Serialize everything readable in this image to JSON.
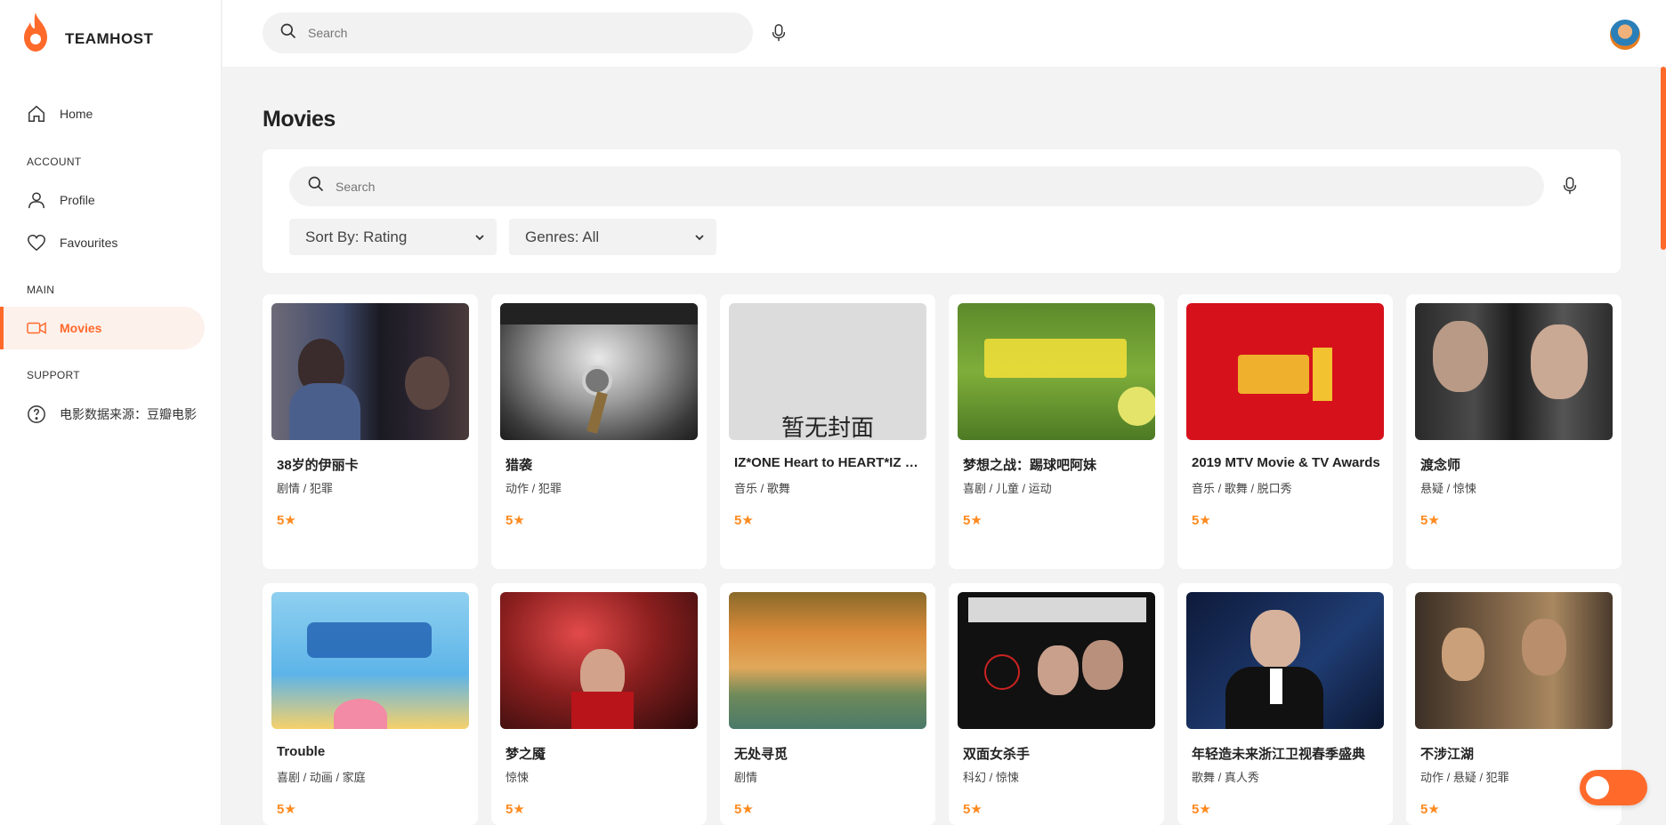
{
  "brand": {
    "name": "TEAMHOST",
    "accent": "#ff6a2b"
  },
  "sidebar": {
    "home": "Home",
    "account_label": "ACCOUNT",
    "profile": "Profile",
    "favourites": "Favourites",
    "main_label": "MAIN",
    "movies": "Movies",
    "support_label": "SUPPORT",
    "source": "电影数据来源：豆瓣电影"
  },
  "top_search": {
    "placeholder": "Search"
  },
  "page_title": "Movies",
  "filters": {
    "search_placeholder": "Search",
    "sort": "Sort By: Rating",
    "genres": "Genres: All"
  },
  "movies": [
    {
      "title": "38岁的伊丽卡",
      "genres": "剧情 / 犯罪",
      "rating": "5★"
    },
    {
      "title": "猎袭",
      "genres": "动作 / 犯罪",
      "rating": "5★"
    },
    {
      "title": "IZ*ONE Heart to HEART*IZ Concert",
      "genres": "音乐 / 歌舞",
      "rating": "5★",
      "poster_text": "暂无封面"
    },
    {
      "title": "梦想之战：踢球吧阿妹",
      "genres": "喜剧 / 儿童 / 运动",
      "rating": "5★"
    },
    {
      "title": "2019 MTV Movie & TV Awards",
      "genres": "音乐 / 歌舞 / 脱口秀",
      "rating": "5★"
    },
    {
      "title": "渡念师",
      "genres": "悬疑 / 惊悚",
      "rating": "5★"
    },
    {
      "title": "Trouble",
      "genres": "喜剧 / 动画 / 家庭",
      "rating": "5★"
    },
    {
      "title": "梦之魇",
      "genres": "惊悚",
      "rating": "5★"
    },
    {
      "title": "无处寻觅",
      "genres": "剧情",
      "rating": "5★"
    },
    {
      "title": "双面女杀手",
      "genres": "科幻 / 惊悚",
      "rating": "5★"
    },
    {
      "title": "年轻造未来浙江卫视春季盛典",
      "genres": "歌舞 / 真人秀",
      "rating": "5★"
    },
    {
      "title": "不涉江湖",
      "genres": "动作 / 悬疑 / 犯罪",
      "rating": "5★"
    }
  ]
}
